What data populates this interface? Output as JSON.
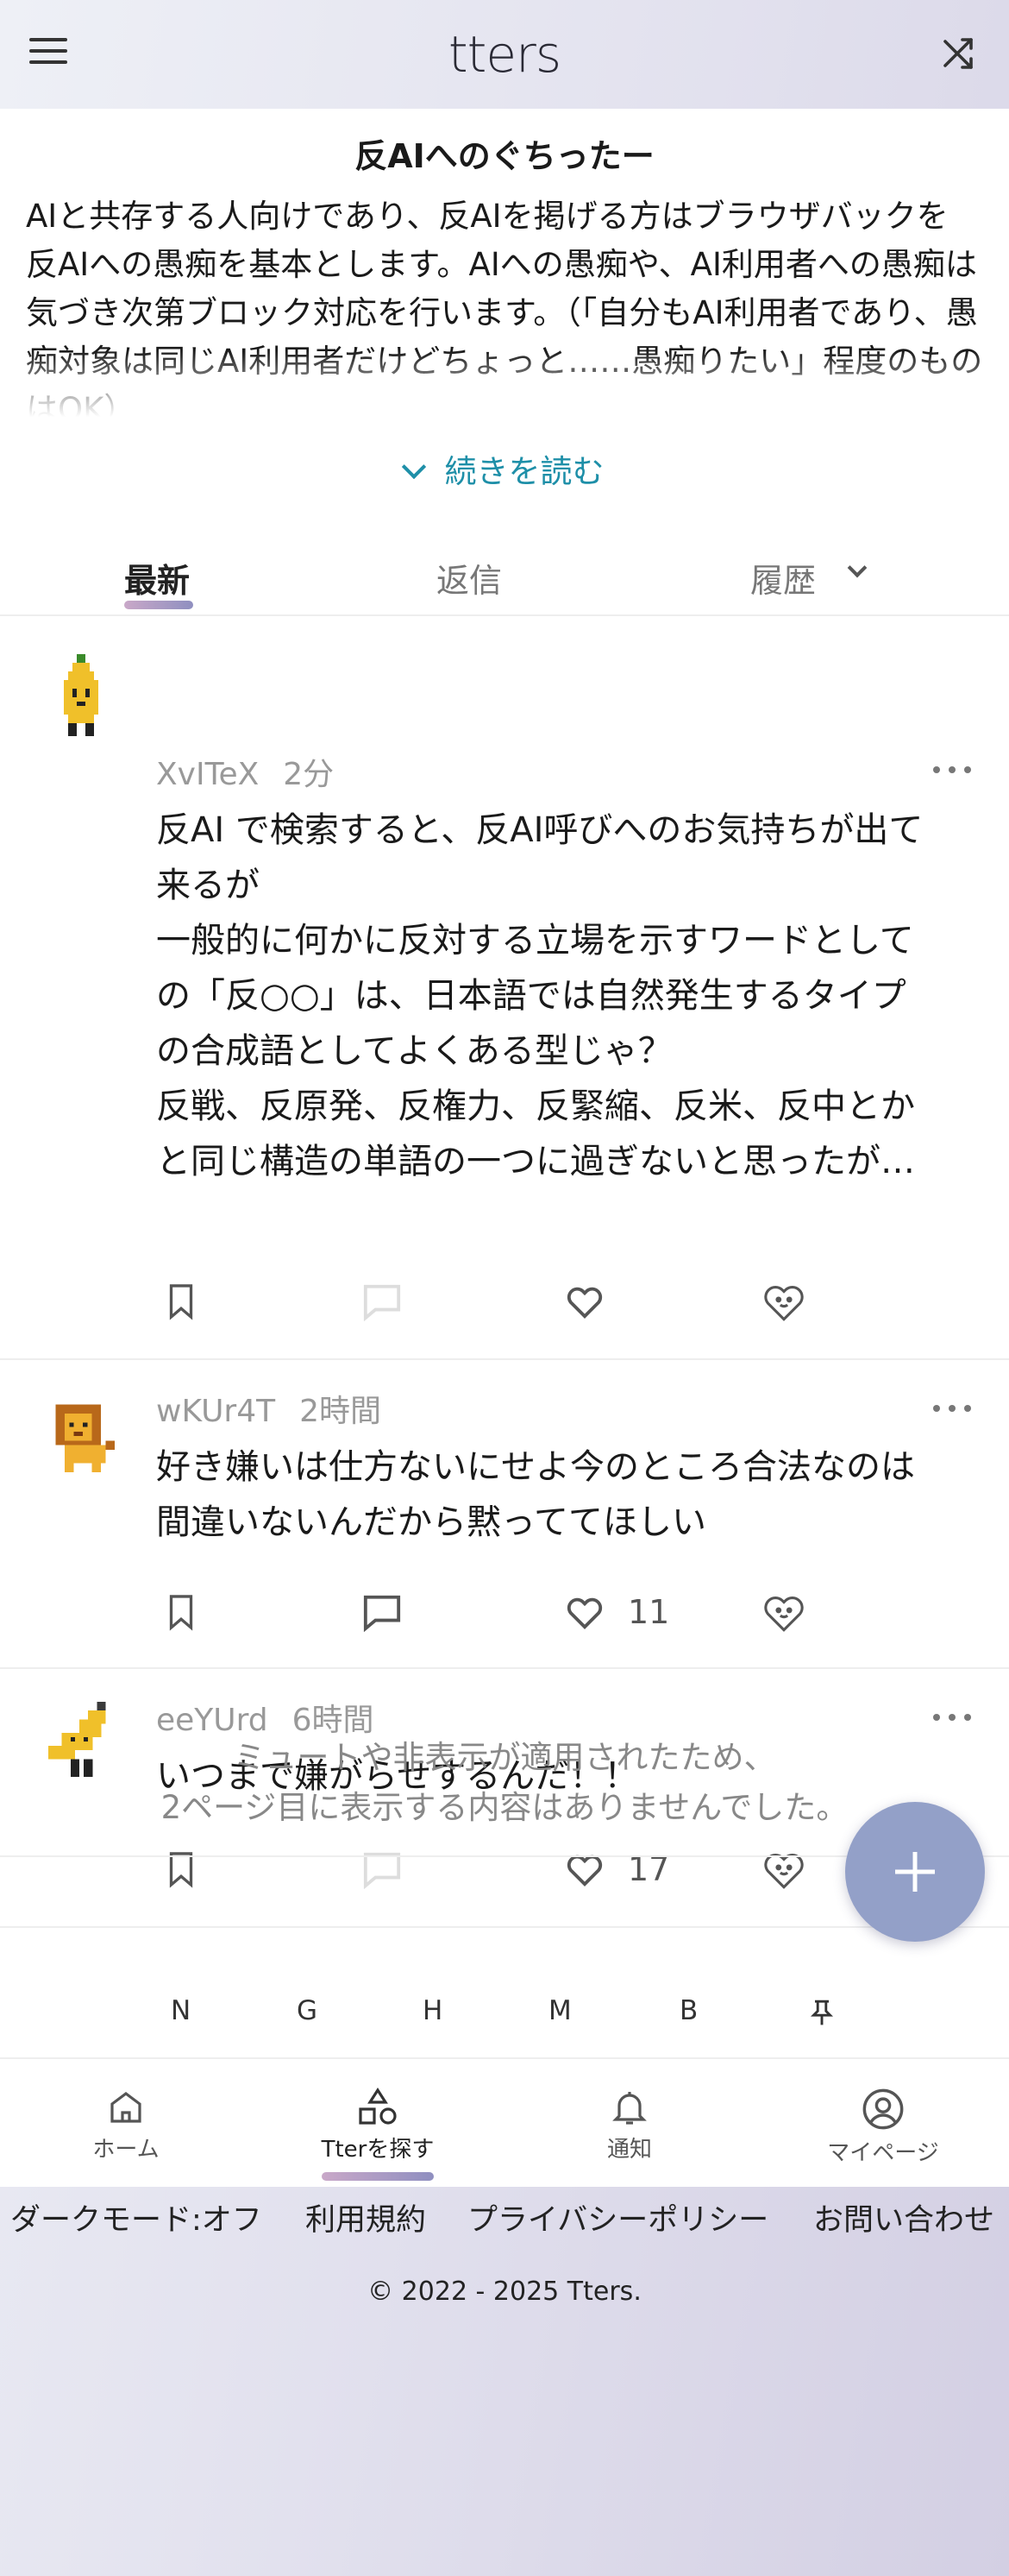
{
  "header": {
    "logo": "tters",
    "menu_icon": "menu-icon",
    "shuffle_icon": "shuffle-icon"
  },
  "description": {
    "title": "反AIへのぐちったー",
    "body": "AIと共存する人向けであり、反AIを掲げる方はブラウザバックを\n反AIへの愚痴を基本とします。AIへの愚痴や、AI利用者への愚痴は気づき次第ブロック対応を行います。（「自分もAI利用者であり、愚痴対象は同じAI利用者だけどちょっと……愚痴りたい」程度のものはOK）",
    "read_more": "続きを読む"
  },
  "tabs": [
    {
      "label": "最新",
      "active": true
    },
    {
      "label": "返信",
      "active": false
    },
    {
      "label": "履歴",
      "active": false
    }
  ],
  "posts": [
    {
      "user": "XvITeX",
      "time": "2分",
      "text": "反AI で検索すると、反AI呼びへのお気持ちが出て来るが\n一般的に何かに反対する立場を示すワードとしての「反○○」は、日本語では自然発生するタイプの合成語としてよくある型じゃ？\n反戦、反原発、反権力、反緊縮、反米、反中とかと同じ構造の単語の一つに過ぎないと思ったが…",
      "likes": "",
      "reply_enabled": false
    },
    {
      "user": "wKUr4T",
      "time": "2時間",
      "text": "好き嫌いは仕方ないにせよ今のところ合法なのは間違いないんだから黙っててほしい",
      "likes": "11",
      "reply_enabled": true
    },
    {
      "user": "eeYUrd",
      "time": "6時間",
      "text": "いつまで嫌がらせするんだ！！",
      "likes": "17",
      "reply_enabled": false
    }
  ],
  "notice": "ミュートや非表示が適用されたため、\n2ページ目に表示する内容はありませんでした。",
  "letters": [
    "N",
    "G",
    "H",
    "M",
    "B",
    "pin"
  ],
  "bottom_nav": [
    {
      "label": "ホーム",
      "icon": "home-icon"
    },
    {
      "label": "Tterを探す",
      "icon": "shapes-icon",
      "active": true
    },
    {
      "label": "通知",
      "icon": "bell-icon"
    },
    {
      "label": "マイページ",
      "icon": "user-circle-icon"
    }
  ],
  "footer": {
    "links": [
      "ダークモード:オフ",
      "利用規約",
      "プライバシーポリシー",
      "お問い合わせ"
    ],
    "copyright": "© 2022 - 2025 Tters."
  },
  "colors": {
    "accent": "#1e8fa8",
    "fab": "#93a0c8"
  }
}
